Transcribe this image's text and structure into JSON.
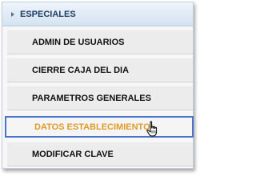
{
  "menu": {
    "header_title": "ESPECIALES",
    "items": [
      {
        "label": "ADMIN DE USUARIOS"
      },
      {
        "label": "CIERRE CAJA DEL DIA"
      },
      {
        "label": "PARAMETROS GENERALES"
      },
      {
        "label": "DATOS ESTABLECIMIENTO",
        "state": "hovered"
      },
      {
        "label": "MODIFICAR CLAVE"
      }
    ]
  },
  "colors": {
    "header_text": "#1f3c66",
    "active_text": "#e09a2a",
    "active_border": "#4a74c9"
  },
  "icons": {
    "header": "chevron-right-icon",
    "cursor": "hand-pointer-icon"
  }
}
